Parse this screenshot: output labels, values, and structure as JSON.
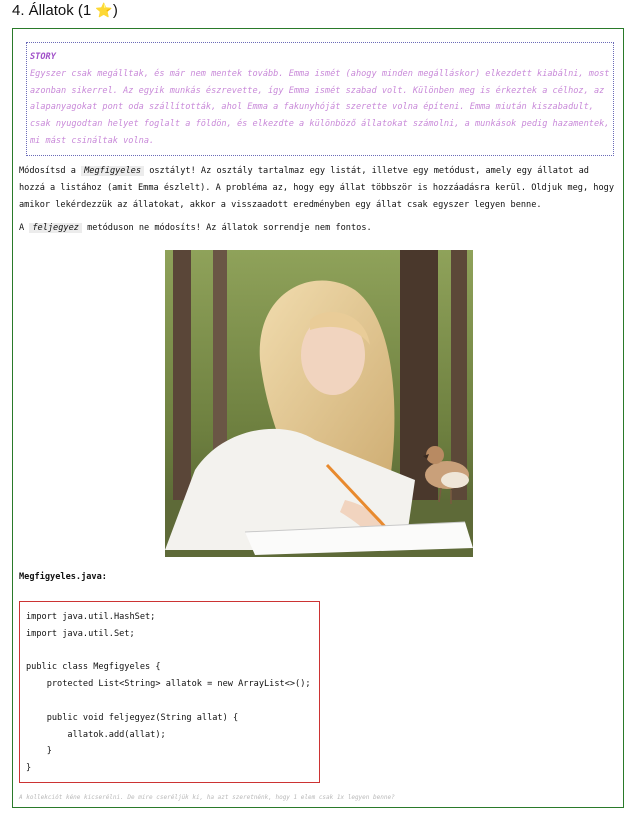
{
  "header": {
    "title_prefix": "4. Állatok (1",
    "star": "⭐",
    "title_suffix": ")"
  },
  "story": {
    "label": "STORY",
    "text": "Egyszer csak megálltak, és már nem mentek tovább. Emma ismét (ahogy minden megállásk­or) elkezdett kiabálni, most azonban sikerrel. Az egyik munkás észrevette, így Emma ismét szabad volt. Különben meg is érkeztek a célhoz, az alapanyagokat pont oda szállították, ahol Emma a fakunyhóját szerette volna építeni. Emma miután kiszabadult, csak nyugodtan helyet foglalt a földön, és elkezdte a különböző állatokat számolni, a munkások pedig hazamentek, mi mást csináltak volna."
  },
  "task": {
    "p1_a": "Módosítsd a ",
    "p1_code": "Megfigyeles",
    "p1_b": " osztályt! Az osztály tartalmaz egy listát, illetve egy metódust, amely egy állatot ad hozzá a listához (amit Emma észlelt). A probléma az, hogy egy állat többször is hozzáadásra kerül. Oldjuk meg, hogy amikor lekérdezzük az állatokat, akkor a visszaadott eredményben egy állat csak egyszer legyen benne.",
    "p2_a": "A ",
    "p2_code": "feljegyez",
    "p2_b": " metóduson ne módosíts! Az állatok sorrendje nem fontos."
  },
  "file_label": "Megfigyeles.java:",
  "code": "import java.util.HashSet;\nimport java.util.Set;\n\npublic class Megfigyeles {\n    protected List<String> allatok = new ArrayList<>();\n\n    public void feljegyez(String allat) {\n        allatok.add(allat);\n    }\n}",
  "hint": "A kollekciót kéne kicserélni. De mire cseréljük ki, ha azt szeretnénk, hogy 1 elem csak 1x legyen benne?",
  "colors": {
    "box_border": "#2a7a2a",
    "story_border": "#6b6bb8",
    "story_text": "#c98ad9",
    "story_label": "#a04fc8",
    "code_border": "#cc3333"
  }
}
